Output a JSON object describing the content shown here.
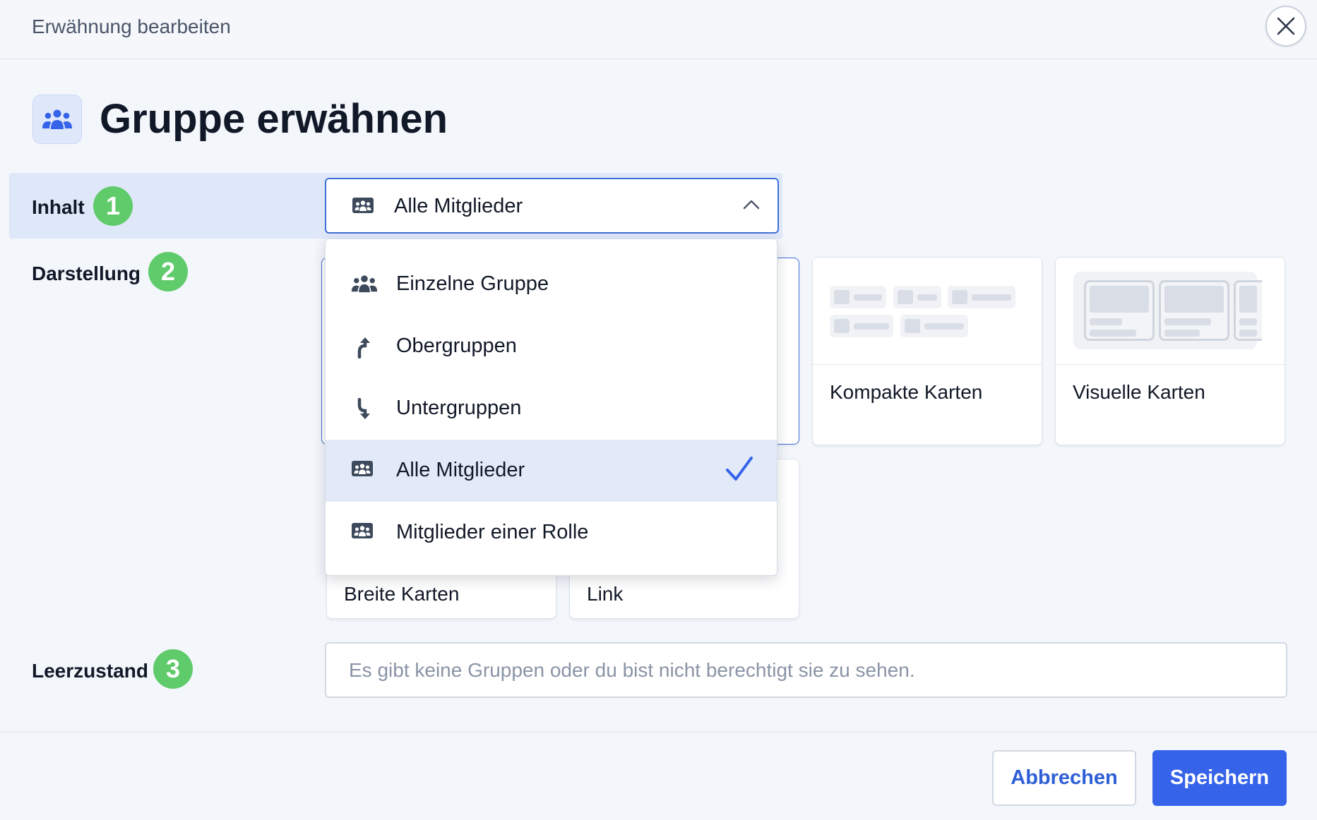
{
  "header": {
    "title": "Erwähnung bearbeiten"
  },
  "page": {
    "title": "Gruppe erwähnen"
  },
  "rows": {
    "content": {
      "label": "Inhalt",
      "badge": "1"
    },
    "display": {
      "label": "Darstellung",
      "badge": "2"
    },
    "empty": {
      "label": "Leerzustand",
      "badge": "3"
    }
  },
  "select": {
    "value": "Alle Mitglieder"
  },
  "dropdown": {
    "options": [
      {
        "label": "Einzelne Gruppe",
        "icon": "group-icon",
        "selected": false
      },
      {
        "label": "Obergruppen",
        "icon": "arrow-up-icon",
        "selected": false
      },
      {
        "label": "Untergruppen",
        "icon": "arrow-down-icon",
        "selected": false
      },
      {
        "label": "Alle Mitglieder",
        "icon": "members-icon",
        "selected": true
      },
      {
        "label": "Mitglieder einer Rolle",
        "icon": "members-icon",
        "selected": false
      }
    ]
  },
  "cards": [
    {
      "label": "Kompakte Karten"
    },
    {
      "label": "Visuelle Karten"
    },
    {
      "label": "Breite Karten"
    },
    {
      "label": "Link"
    }
  ],
  "empty_state": {
    "placeholder": "Es gibt keine Gruppen oder du bist nicht berechtigt sie zu sehen."
  },
  "footer": {
    "cancel_label": "Abbrechen",
    "save_label": "Speichern"
  },
  "colors": {
    "accent": "#3563e9",
    "badge": "#5fcb6b",
    "selected_bg": "#e2eafa"
  }
}
